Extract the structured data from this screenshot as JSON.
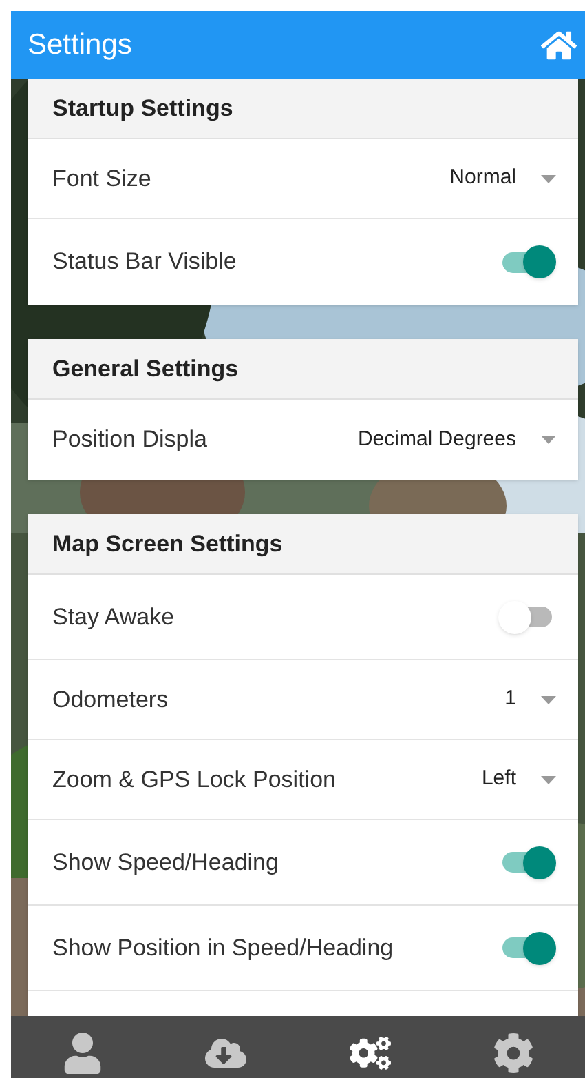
{
  "header": {
    "title": "Settings"
  },
  "sections": [
    {
      "title": "Startup Settings",
      "rows": [
        {
          "kind": "dropdown",
          "label": "Font Size",
          "value": "Normal"
        },
        {
          "kind": "toggle",
          "label": "Status Bar Visible",
          "on": true
        }
      ]
    },
    {
      "title": "General Settings",
      "rows": [
        {
          "kind": "dropdown",
          "label": "Position Displa",
          "value": "Decimal Degrees"
        }
      ]
    },
    {
      "title": "Map Screen Settings",
      "rows": [
        {
          "kind": "toggle",
          "label": "Stay Awake",
          "on": false
        },
        {
          "kind": "dropdown",
          "label": "Odometers",
          "value": "1"
        },
        {
          "kind": "dropdown",
          "label": "Zoom & GPS Lock Position",
          "value": "Left"
        },
        {
          "kind": "toggle",
          "label": "Show Speed/Heading",
          "on": true
        },
        {
          "kind": "toggle",
          "label": "Show Position in Speed/Heading",
          "on": true
        },
        {
          "kind": "blank"
        }
      ]
    }
  ],
  "tabs": [
    {
      "kind": "user",
      "selected": false
    },
    {
      "kind": "cloud",
      "selected": false
    },
    {
      "kind": "gears",
      "selected": true
    },
    {
      "kind": "gear",
      "selected": false
    }
  ]
}
